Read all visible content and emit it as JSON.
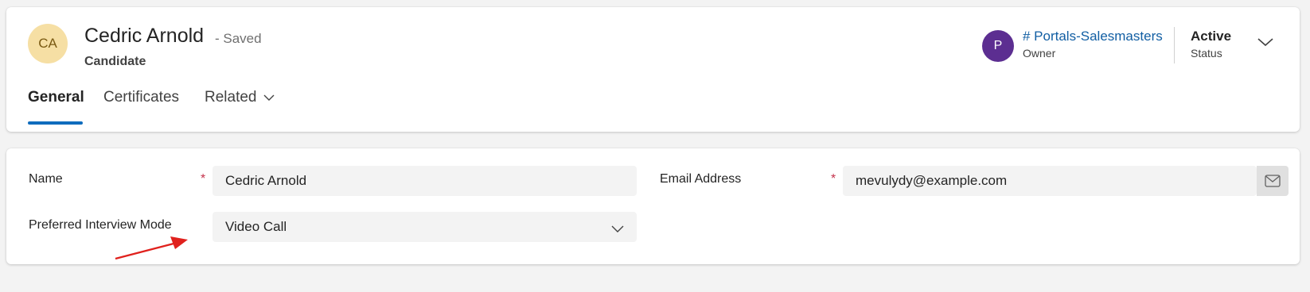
{
  "header": {
    "avatar_initials": "CA",
    "record_title": "Cedric Arnold",
    "saved_state": "- Saved",
    "entity_name": "Candidate",
    "owner": {
      "avatar_initial": "P",
      "name": "# Portals-Salesmasters",
      "label": "Owner"
    },
    "status": {
      "value": "Active",
      "label": "Status"
    }
  },
  "tabs": [
    {
      "label": "General",
      "active": true
    },
    {
      "label": "Certificates",
      "active": false
    },
    {
      "label": "Related",
      "active": false
    }
  ],
  "form": {
    "name": {
      "label": "Name",
      "required_marker": "*",
      "value": "Cedric Arnold"
    },
    "email": {
      "label": "Email Address",
      "required_marker": "*",
      "value": "mevulydy@example.com"
    },
    "interview_mode": {
      "label": "Preferred Interview Mode",
      "value": "Video Call"
    }
  },
  "icons": {
    "expand": "chevron-down-icon",
    "related_dropdown": "chevron-down-icon",
    "mail": "mail-icon",
    "select_dropdown": "chevron-down-icon"
  },
  "colors": {
    "accent": "#0f6cbd",
    "link": "#115ea3",
    "required": "#c4314b",
    "owner_avatar": "#5c2e91",
    "record_avatar": "#f6dfa4",
    "annotation_arrow": "#e0211d"
  }
}
